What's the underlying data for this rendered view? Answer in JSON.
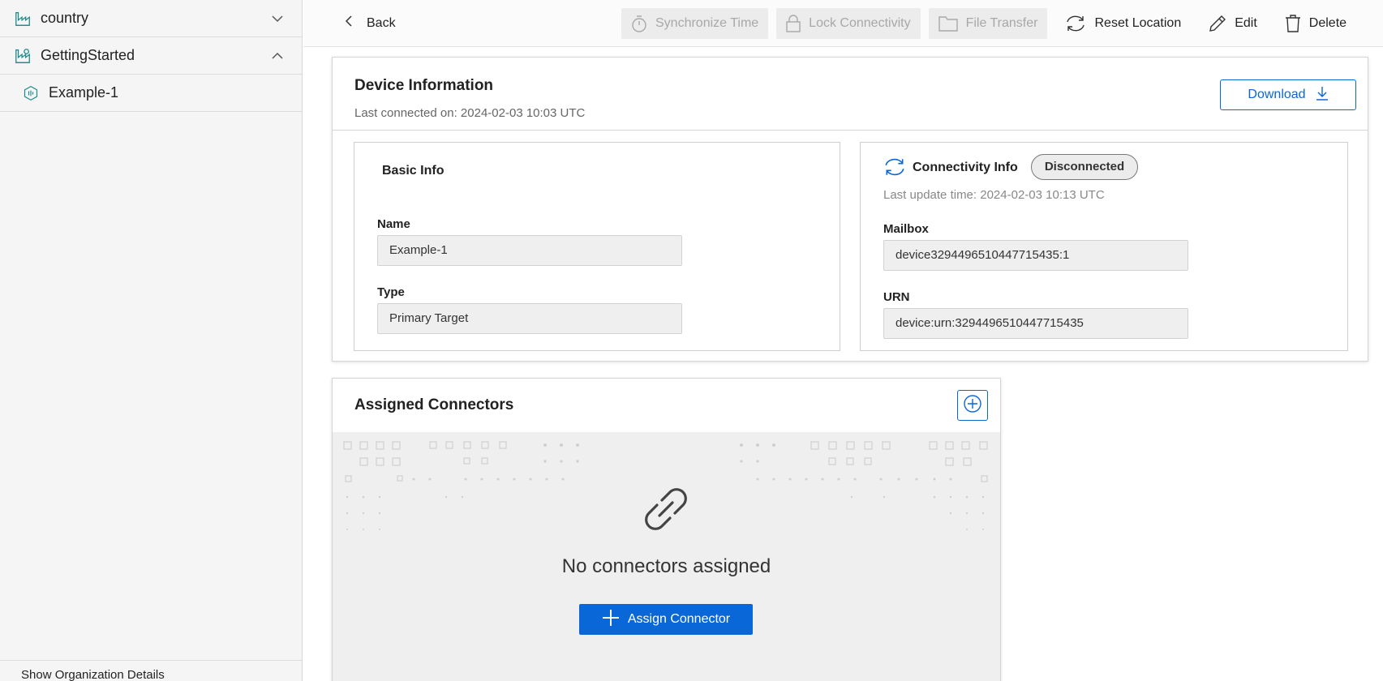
{
  "sidebar": {
    "items": [
      {
        "label": "country",
        "icon": "factory-icon",
        "chevron": "down"
      },
      {
        "label": "GettingStarted",
        "icon": "factory-icon",
        "chevron": "up"
      },
      {
        "label": "Example-1",
        "icon": "device-icon"
      }
    ],
    "footer": "Show Organization Details"
  },
  "toolbar": {
    "back": "Back",
    "sync_time": "Synchronize Time",
    "lock_connectivity": "Lock Connectivity",
    "file_transfer": "File Transfer",
    "reset_location": "Reset Location",
    "edit": "Edit",
    "delete": "Delete"
  },
  "device": {
    "title": "Device Information",
    "last_connected": "Last connected on: 2024-02-03 10:03 UTC",
    "download": "Download",
    "basic": {
      "title": "Basic Info",
      "name_label": "Name",
      "name_value": "Example-1",
      "type_label": "Type",
      "type_value": "Primary Target"
    },
    "connectivity": {
      "title": "Connectivity Info",
      "status": "Disconnected",
      "last_update": "Last update time: 2024-02-03 10:13 UTC",
      "mailbox_label": "Mailbox",
      "mailbox_value": "device3294496510447715435:1",
      "urn_label": "URN",
      "urn_value": "device:urn:3294496510447715435"
    }
  },
  "connectors": {
    "title": "Assigned Connectors",
    "empty_text": "No connectors assigned",
    "assign_button": "Assign Connector"
  },
  "colors": {
    "accent": "#0a67d8",
    "tree_icon": "#1b8a8a"
  }
}
